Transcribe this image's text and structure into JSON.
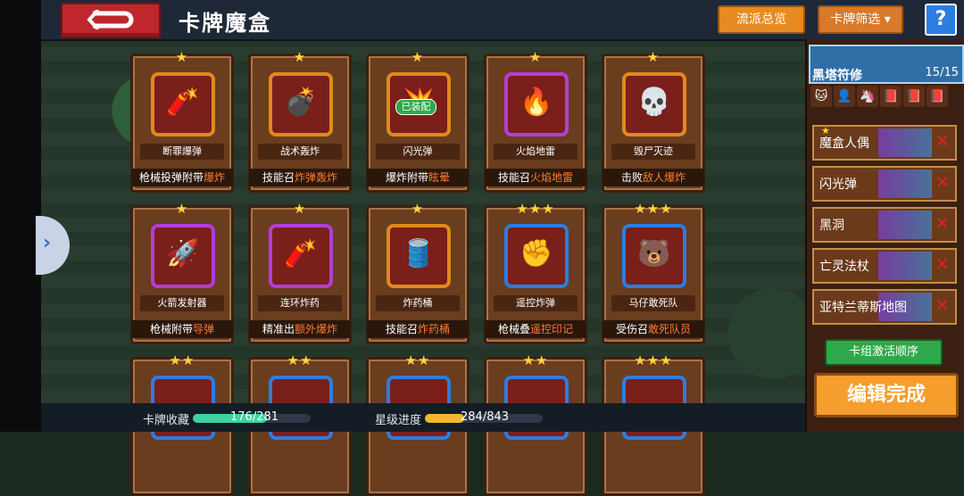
{
  "header": {
    "title": "卡牌魔盒",
    "school_overview_label": "流派总览",
    "filter_label": "卡牌筛选",
    "help_label": "?"
  },
  "cards": [
    {
      "name": "断罪爆弹",
      "desc_pre": "枪械投弹附带",
      "desc_hi": "爆炸",
      "stars": "★",
      "icon": "🧨",
      "equipped": false,
      "frame": "#e08a1c"
    },
    {
      "name": "战术轰炸",
      "desc_pre": "技能召",
      "desc_hi": "炸弹轰炸",
      "stars": "★",
      "icon": "💣",
      "equipped": false,
      "frame": "#e08a1c"
    },
    {
      "name": "闪光弹",
      "desc_pre": "爆炸附带",
      "desc_hi": "眩晕",
      "stars": "★",
      "icon": "💥",
      "equipped": true,
      "equipped_label": "已装配",
      "frame": "#e08a1c"
    },
    {
      "name": "火焰地雷",
      "desc_pre": "技能召",
      "desc_hi": "火焰地雷",
      "stars": "★",
      "icon": "🔥",
      "equipped": false,
      "frame": "#b23ed6"
    },
    {
      "name": "毁尸灭迹",
      "desc_pre": "击败",
      "desc_hi": "敌人爆炸",
      "stars": "★",
      "icon": "💀",
      "equipped": false,
      "frame": "#e08a1c"
    },
    {
      "name": "火箭发射器",
      "desc_pre": "枪械附带",
      "desc_hi": "导弹",
      "stars": "★",
      "icon": "🚀",
      "equipped": false,
      "frame": "#b23ed6"
    },
    {
      "name": "连环炸药",
      "desc_pre": "精准出",
      "desc_hi": "额外爆炸",
      "stars": "★",
      "icon": "🧨",
      "equipped": false,
      "frame": "#b23ed6"
    },
    {
      "name": "炸药桶",
      "desc_pre": "技能召",
      "desc_hi": "炸药桶",
      "stars": "★",
      "icon": "🛢️",
      "equipped": false,
      "frame": "#e08a1c"
    },
    {
      "name": "遥控炸弹",
      "desc_pre": "枪械叠",
      "desc_hi": "遥控印记",
      "stars": "★★★",
      "icon": "✊",
      "equipped": false,
      "frame": "#2d7de0"
    },
    {
      "name": "马仔敢死队",
      "desc_pre": "受伤召",
      "desc_hi": "敢死队员",
      "stars": "★★★",
      "icon": "🐻",
      "equipped": false,
      "frame": "#2d7de0"
    },
    {
      "name": "",
      "desc_pre": "",
      "desc_hi": "",
      "stars": "★★",
      "icon": "",
      "equipped": false,
      "frame": "#2d7de0"
    },
    {
      "name": "",
      "desc_pre": "",
      "desc_hi": "",
      "stars": "★★",
      "icon": "",
      "equipped": false,
      "frame": "#2d7de0"
    },
    {
      "name": "",
      "desc_pre": "",
      "desc_hi": "",
      "stars": "★★",
      "icon": "",
      "equipped": false,
      "frame": "#2d7de0"
    },
    {
      "name": "",
      "desc_pre": "",
      "desc_hi": "",
      "stars": "★★",
      "icon": "",
      "equipped": false,
      "frame": "#2d7de0"
    },
    {
      "name": "",
      "desc_pre": "",
      "desc_hi": "",
      "stars": "★★★",
      "icon": "",
      "equipped": false,
      "frame": "#2d7de0"
    }
  ],
  "footer": {
    "collection_label": "卡牌收藏",
    "collection_value": "176/281",
    "collection_fraction": 0.626,
    "stars_label": "星级进度",
    "stars_value": "284/843",
    "stars_fraction": 0.337
  },
  "deck": {
    "name": "黑塔符修",
    "count": "15/15",
    "icons": [
      "🐱",
      "👤",
      "🦄",
      "📕",
      "📕",
      "📕"
    ],
    "items": [
      {
        "label": "魔盒人偶",
        "star": "★"
      },
      {
        "label": "闪光弹",
        "star": ""
      },
      {
        "label": "黑洞",
        "star": ""
      },
      {
        "label": "亡灵法杖",
        "star": ""
      },
      {
        "label": "亚特兰蒂斯地图",
        "star": ""
      }
    ],
    "remove_label": "✕",
    "order_button": "卡组激活顺序",
    "done_button": "编辑完成"
  }
}
